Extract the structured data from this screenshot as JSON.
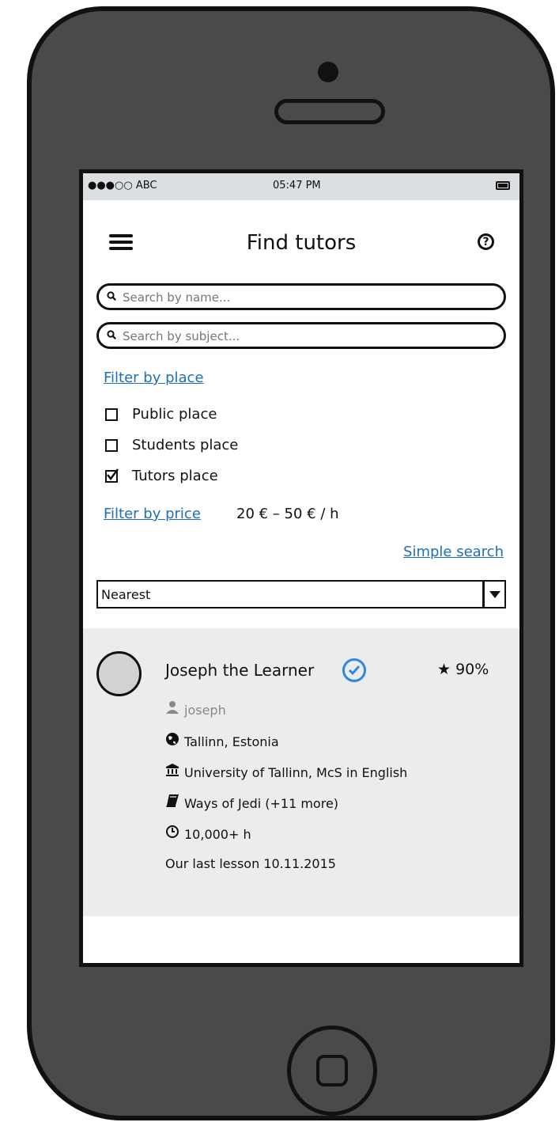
{
  "status_bar": {
    "carrier": "●●●○○ ABC",
    "time": "05:47 PM"
  },
  "header": {
    "title": "Find tutors",
    "menu_icon": "hamburger-menu-icon",
    "help_icon": "help-icon"
  },
  "search": {
    "name_placeholder": "Search by name...",
    "subject_placeholder": "Search by subject..."
  },
  "filters": {
    "place_label": "Filter by place",
    "places": [
      {
        "label": "Public place",
        "checked": false
      },
      {
        "label": "Students place",
        "checked": false
      },
      {
        "label": "Tutors place",
        "checked": true
      }
    ],
    "price_label": "Filter by price",
    "price_range": "20 € – 50 € / h",
    "simple_search_label": "Simple search"
  },
  "sort": {
    "selected": "Nearest"
  },
  "tutor": {
    "name": "Joseph the Learner",
    "rating": "90%",
    "username": "joseph",
    "location": "Tallinn, Estonia",
    "education": "University of Tallinn, McS in English",
    "subjects": "Ways of Jedi (+11 more)",
    "hours": "10,000+ h",
    "last_lesson": "Our last lesson 10.11.2015",
    "accent_color": "#2c87e6"
  }
}
